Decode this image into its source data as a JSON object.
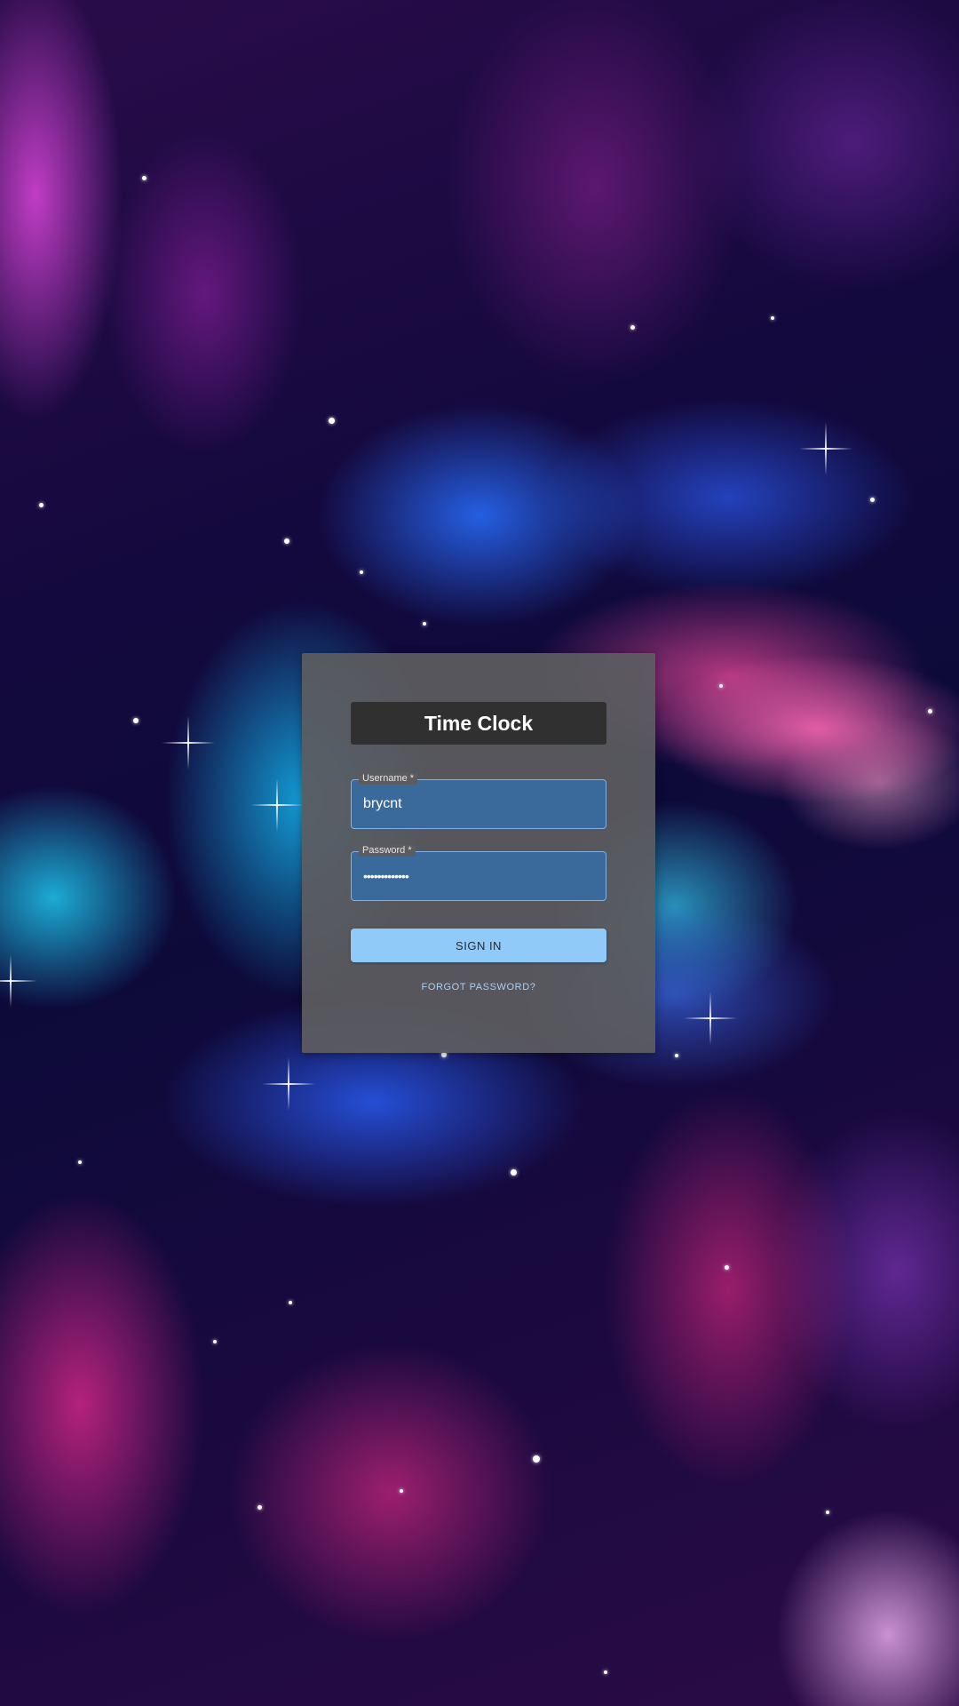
{
  "login": {
    "title": "Time Clock",
    "username_label": "Username *",
    "username_value": "brycnt",
    "password_label": "Password *",
    "password_value": "•••••••••••••",
    "signin_label": "SIGN IN",
    "forgot_label": "FORGOT PASSWORD?"
  },
  "colors": {
    "card": "#5c5c60",
    "title_bar": "#303030",
    "field_fill": "#3a6a9c",
    "button": "#90caf9"
  }
}
